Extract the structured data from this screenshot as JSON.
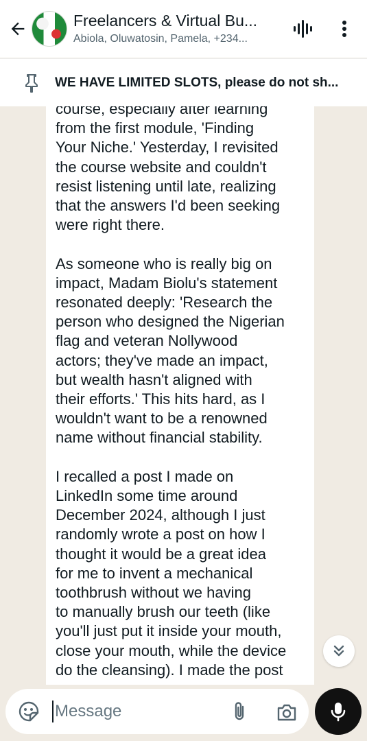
{
  "header": {
    "title": "Freelancers & Virtual Bu...",
    "subtitle": "Abiola, Oluwatosin, Pamela, +234..."
  },
  "pinned": {
    "text": "WE HAVE LIMITED SLOTS, please do not sh..."
  },
  "message": {
    "text": "course, especially after learning\nfrom the first module, 'Finding\nYour Niche.' Yesterday, I revisited\nthe course website and couldn't\nresist listening until late, realizing\nthat the answers I'd been seeking\nwere right there.\n\nAs someone who is really big on\nimpact, Madam Biolu's statement\nresonated deeply: 'Research the\nperson who designed the Nigerian\nflag and veteran Nollywood\nactors; they've made an impact,\nbut wealth hasn't aligned with\ntheir efforts.' This hits hard, as I\nwouldn't want to be a renowned\nname without financial stability.\n\nI recalled a post I made on\nLinkedIn some time around\nDecember 2024, although I just\nrandomly wrote a post on how I\nthought it would be a great idea\nfor me to invent a mechanical\ntoothbrush without we having\nto manually brush our teeth (like\nyou'll just put it inside your mouth,\nclose your mouth, while the device\ndo the cleansing). I made the post"
  },
  "input": {
    "placeholder": "Message"
  },
  "icons": {
    "back": "arrow-left-icon",
    "voice": "voice-call-icon",
    "menu": "more-vertical-icon",
    "pin": "pin-icon",
    "scroll": "double-chevron-down-icon",
    "emoji": "sticker-emoji-icon",
    "attach": "paperclip-icon",
    "camera": "camera-icon",
    "mic": "microphone-icon"
  },
  "colors": {
    "chat_background": "#f0ebe3",
    "header_background": "#ffffff",
    "mic_button": "#111111"
  }
}
